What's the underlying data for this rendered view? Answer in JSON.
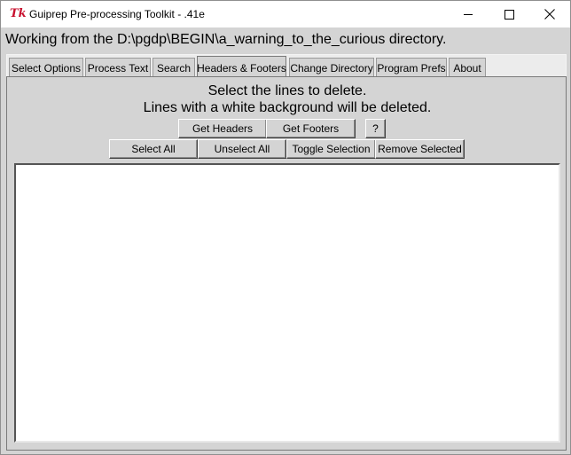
{
  "window": {
    "title": "Guiprep Pre-processing Toolkit - .41e",
    "app_icon_glyph": "Tk"
  },
  "path_line": "Working from the D:\\pgdp\\BEGIN\\a_warning_to_the_curious directory.",
  "tabs": [
    {
      "label": "Select Options",
      "active": false
    },
    {
      "label": "Process Text",
      "active": false
    },
    {
      "label": "Search",
      "active": false
    },
    {
      "label": "Headers & Footers",
      "active": true
    },
    {
      "label": "Change Directory",
      "active": false
    },
    {
      "label": "Program Prefs",
      "active": false
    },
    {
      "label": "About",
      "active": false
    }
  ],
  "headers_footers": {
    "instruction_line1": "Select the lines to delete.",
    "instruction_line2": "Lines with a white background will be deleted.",
    "get_headers_label": "Get Headers",
    "get_footers_label": "Get Footers",
    "help_label": "?",
    "select_all_label": "Select All",
    "unselect_all_label": "Unselect All",
    "toggle_selection_label": "Toggle Selection",
    "remove_selected_label": "Remove Selected",
    "lines": []
  },
  "colors": {
    "window_bg": "#d4d4d4",
    "listbox_bg": "#ffffff",
    "tk_icon": "#c8102e"
  }
}
